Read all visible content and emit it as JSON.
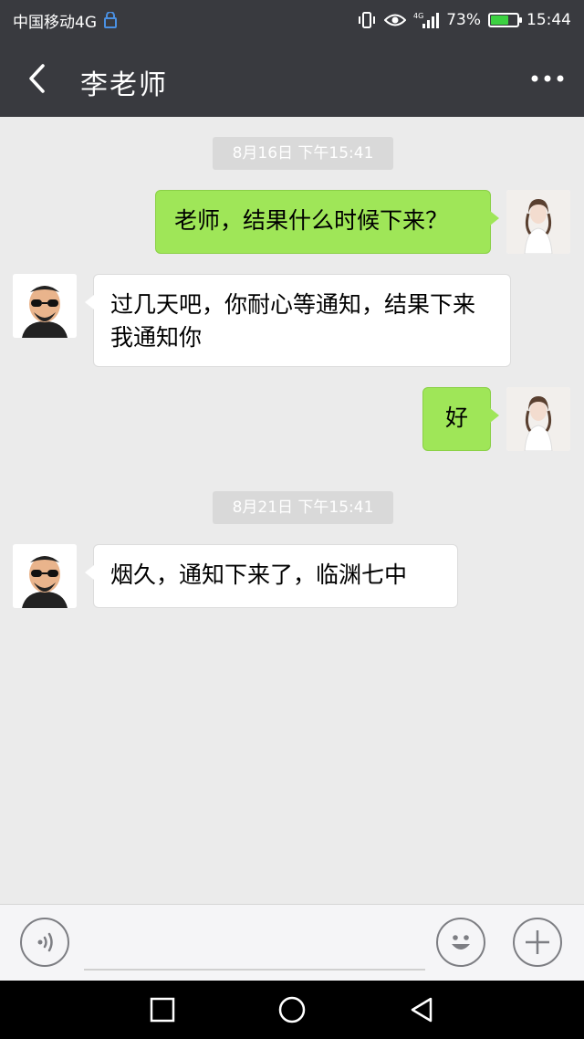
{
  "status_bar": {
    "carrier": "中国移动4G",
    "battery_percent": "73%",
    "battery_level": 0.73,
    "time": "15:44",
    "network_label": "4G"
  },
  "header": {
    "title": "李老师"
  },
  "messages": [
    {
      "type": "timestamp",
      "text": "8月16日 下午15:41"
    },
    {
      "type": "outgoing",
      "text": "老师，结果什么时候下来？"
    },
    {
      "type": "incoming",
      "text": "过几天吧，你耐心等通知，结果下来我通知你"
    },
    {
      "type": "outgoing",
      "text": "好"
    },
    {
      "type": "timestamp",
      "text": "8月21日 下午15:41"
    },
    {
      "type": "incoming",
      "text": "烟久，通知下来了，临渊七中"
    }
  ],
  "input_bar": {
    "value": "",
    "placeholder": ""
  },
  "colors": {
    "bar_dark": "#393a3f",
    "chat_bg": "#ebebeb",
    "bubble_out": "#9fe658",
    "bubble_in": "#ffffff",
    "battery": "#3cd141"
  }
}
